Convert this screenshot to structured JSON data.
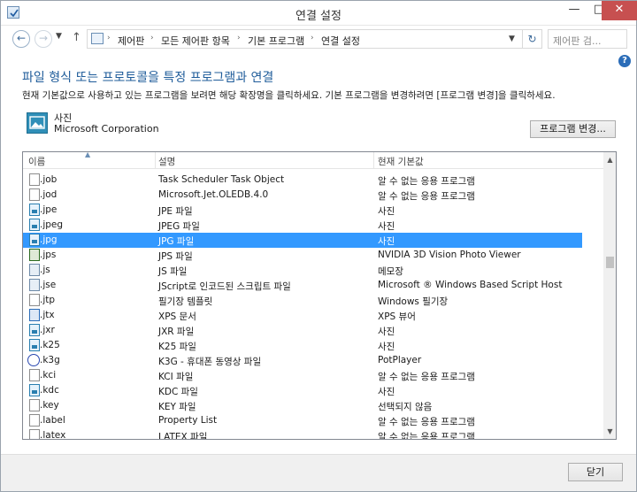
{
  "window": {
    "title": "연결 설정",
    "minimize": "—",
    "maximize": "□",
    "close": "✕"
  },
  "nav": {
    "breadcrumbs": [
      "제어판",
      "모든 제어판 항목",
      "기본 프로그램",
      "연결 설정"
    ],
    "search_placeholder": "제어판 검..."
  },
  "main": {
    "heading": "파일 형식 또는 프로토콜을 특정 프로그램과 연결",
    "description": "현재 기본값으로 사용하고 있는 프로그램을 보려면 해당 확장명을 클릭하세요. 기본 프로그램을 변경하려면 [프로그램 변경]을 클릭하세요.",
    "current_program": {
      "name": "사진",
      "company": "Microsoft Corporation"
    },
    "change_button": "프로그램 변경..."
  },
  "list": {
    "columns": [
      "이름",
      "설명",
      "현재 기본값"
    ],
    "rows": [
      {
        "name": ".job",
        "desc": "Task Scheduler Task Object",
        "default": "알 수 없는 응용 프로그램",
        "icon": "doc"
      },
      {
        "name": ".jod",
        "desc": "Microsoft.Jet.OLEDB.4.0",
        "default": "알 수 없는 응용 프로그램",
        "icon": "doc"
      },
      {
        "name": ".jpe",
        "desc": "JPE 파일",
        "default": "사진",
        "icon": "img"
      },
      {
        "name": ".jpeg",
        "desc": "JPEG 파일",
        "default": "사진",
        "icon": "img"
      },
      {
        "name": ".jpg",
        "desc": "JPG 파일",
        "default": "사진",
        "icon": "img",
        "selected": true
      },
      {
        "name": ".jps",
        "desc": "JPS 파일",
        "default": "NVIDIA 3D Vision Photo Viewer",
        "icon": "nv"
      },
      {
        "name": ".js",
        "desc": "JS 파일",
        "default": "메모장",
        "icon": "js"
      },
      {
        "name": ".jse",
        "desc": "JScript로 인코드된 스크립트 파일",
        "default": "Microsoft ® Windows Based Script Host",
        "icon": "js"
      },
      {
        "name": ".jtp",
        "desc": "필기장 템플릿",
        "default": "Windows 필기장",
        "icon": "doc"
      },
      {
        "name": ".jtx",
        "desc": "XPS 문서",
        "default": "XPS 뷰어",
        "icon": "xps"
      },
      {
        "name": ".jxr",
        "desc": "JXR 파일",
        "default": "사진",
        "icon": "img"
      },
      {
        "name": ".k25",
        "desc": "K25 파일",
        "default": "사진",
        "icon": "img"
      },
      {
        "name": ".k3g",
        "desc": "K3G - 휴대폰 동영상 파일",
        "default": "PotPlayer",
        "icon": "pot"
      },
      {
        "name": ".kci",
        "desc": "KCI 파일",
        "default": "알 수 없는 응용 프로그램",
        "icon": "doc"
      },
      {
        "name": ".kdc",
        "desc": "KDC 파일",
        "default": "사진",
        "icon": "img"
      },
      {
        "name": ".key",
        "desc": "KEY 파일",
        "default": "선택되지 않음",
        "icon": "doc"
      },
      {
        "name": ".label",
        "desc": "Property List",
        "default": "알 수 없는 응용 프로그램",
        "icon": "doc"
      },
      {
        "name": ".latex",
        "desc": "LATEX 파일",
        "default": "알 수 없는 응용 프로그램",
        "icon": "doc"
      }
    ]
  },
  "footer": {
    "close_button": "닫기"
  }
}
